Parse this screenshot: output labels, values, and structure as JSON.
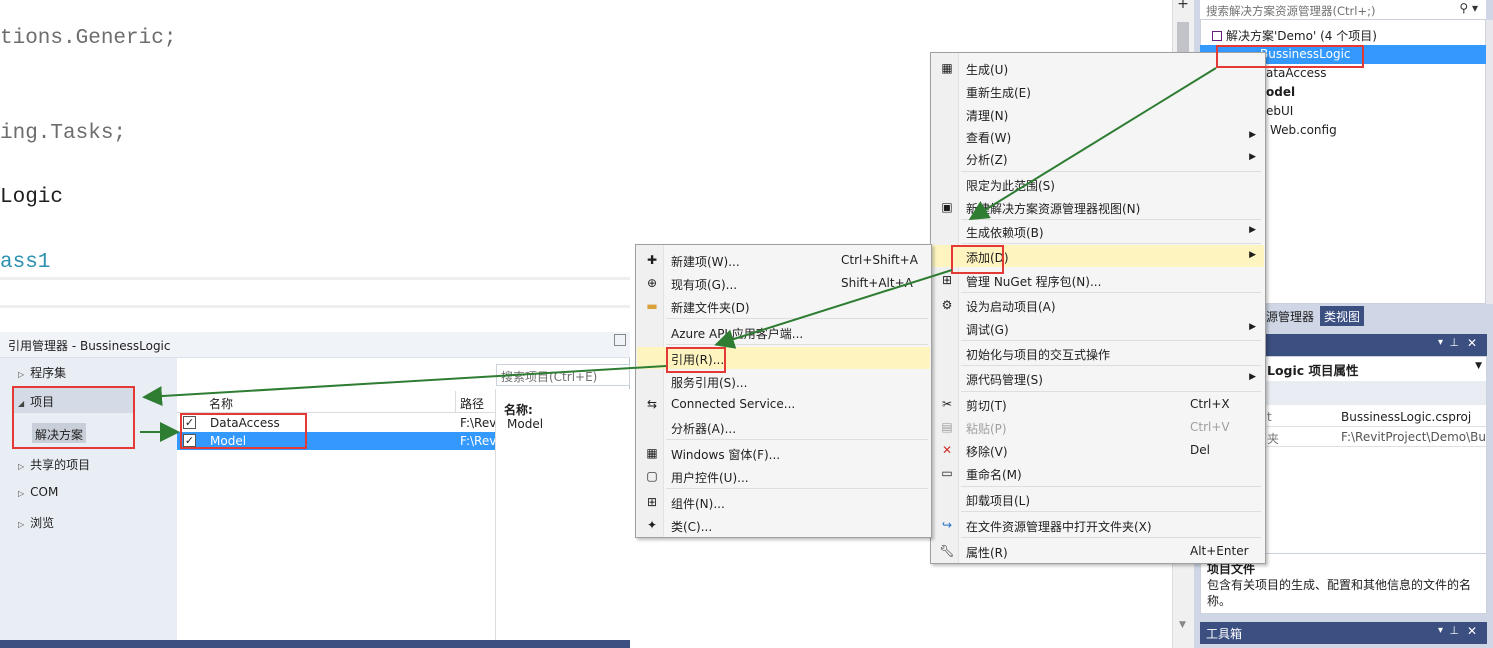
{
  "editor": {
    "lines": [
      {
        "text": "tions.Generic;",
        "color": "#6d6d6d"
      },
      {
        "text": "ing.Tasks;",
        "color": "#6d6d6d"
      },
      {
        "text": "Logic",
        "color": "#1e1e1e"
      },
      {
        "text": "ass1",
        "color": "#2b91af"
      }
    ]
  },
  "solution_explorer": {
    "search_placeholder": "搜索解决方案资源管理器(Ctrl+;)",
    "search_icon": "search-icon",
    "items": [
      "解决方案'Demo' (4 个项目)",
      "BussinessLogic",
      "ataAccess",
      "odel",
      "ebUI",
      "Web.config"
    ]
  },
  "panel_tabs": [
    "源管理器",
    "类视图"
  ],
  "properties": {
    "header_pin": "⊥",
    "title": "Logic 项目属性",
    "rows": [
      {
        "key": "t",
        "value": "BussinessLogic.csproj"
      },
      {
        "key": "夹",
        "value": "F:\\RevitProject\\Demo\\Bu"
      }
    ],
    "desc_title": "项目文件",
    "desc_text": "包含有关项目的生成、配置和其他信息的文件的名称。"
  },
  "toolbox": {
    "title": "工具箱"
  },
  "reference_manager": {
    "title": "引用管理器 - BussinessLogic",
    "search_placeholder": "搜索项目(Ctrl+E)",
    "nav": [
      {
        "label": "程序集",
        "expanded": false
      },
      {
        "label": "项目",
        "expanded": true
      },
      {
        "label": "解决方案",
        "child": true
      },
      {
        "label": "共享的项目",
        "expanded": false
      },
      {
        "label": "COM",
        "expanded": false
      },
      {
        "label": "浏览",
        "expanded": false
      }
    ],
    "columns": [
      "名称",
      "路径"
    ],
    "rows": [
      {
        "name": "DataAccess",
        "path": "F:\\Rev",
        "checked": true
      },
      {
        "name": "Model",
        "path": "F:\\Rev",
        "checked": true
      }
    ],
    "detail_label": "名称:",
    "detail_value": "Model"
  },
  "context_menu_main": {
    "items": [
      {
        "label": "生成(U)",
        "icon": "build-icon"
      },
      {
        "label": "重新生成(E)"
      },
      {
        "label": "清理(N)"
      },
      {
        "label": "查看(W)",
        "submenu": true
      },
      {
        "label": "分析(Z)",
        "submenu": true
      },
      {
        "sep": true
      },
      {
        "label": "限定为此范围(S)"
      },
      {
        "label": "新建解决方案资源管理器视图(N)",
        "icon": "new-view-icon"
      },
      {
        "sep": true
      },
      {
        "label": "生成依赖项(B)",
        "submenu": true
      },
      {
        "sep": true
      },
      {
        "label": "添加(D)",
        "submenu": true,
        "highlight": true
      },
      {
        "label": "管理 NuGet 程序包(N)...",
        "icon": "nuget-icon"
      },
      {
        "sep": true
      },
      {
        "label": "设为启动项目(A)",
        "icon": "gear-icon"
      },
      {
        "label": "调试(G)",
        "submenu": true
      },
      {
        "sep": true
      },
      {
        "label": "初始化与项目的交互式操作"
      },
      {
        "sep": true
      },
      {
        "label": "源代码管理(S)",
        "submenu": true
      },
      {
        "sep": true
      },
      {
        "label": "剪切(T)",
        "shortcut": "Ctrl+X",
        "icon": "cut-icon"
      },
      {
        "label": "粘贴(P)",
        "shortcut": "Ctrl+V",
        "icon": "paste-icon",
        "disabled": true
      },
      {
        "label": "移除(V)",
        "shortcut": "Del",
        "icon": "remove-icon"
      },
      {
        "label": "重命名(M)",
        "icon": "rename-icon"
      },
      {
        "sep": true
      },
      {
        "label": "卸载项目(L)"
      },
      {
        "sep": true
      },
      {
        "label": "在文件资源管理器中打开文件夹(X)",
        "icon": "open-folder-icon"
      },
      {
        "sep": true
      },
      {
        "label": "属性(R)",
        "shortcut": "Alt+Enter",
        "icon": "wrench-icon"
      }
    ]
  },
  "context_menu_add": {
    "items": [
      {
        "label": "新建项(W)...",
        "shortcut": "Ctrl+Shift+A",
        "icon": "new-item-icon"
      },
      {
        "label": "现有项(G)...",
        "shortcut": "Shift+Alt+A",
        "icon": "existing-item-icon"
      },
      {
        "label": "新建文件夹(D)",
        "icon": "new-folder-icon"
      },
      {
        "sep": true
      },
      {
        "label": "Azure API 应用客户端..."
      },
      {
        "sep": true
      },
      {
        "label": "引用(R)...",
        "highlight": true
      },
      {
        "label": "服务引用(S)..."
      },
      {
        "label": "Connected Service...",
        "icon": "connected-service-icon"
      },
      {
        "label": "分析器(A)..."
      },
      {
        "sep": true
      },
      {
        "label": "Windows 窗体(F)...",
        "icon": "form-icon"
      },
      {
        "label": "用户控件(U)...",
        "icon": "user-control-icon"
      },
      {
        "sep": true
      },
      {
        "label": "组件(N)...",
        "icon": "component-icon"
      },
      {
        "label": "类(C)...",
        "icon": "class-icon"
      }
    ]
  },
  "colors": {
    "accent": "#3399ff",
    "annotation_red": "#e53935",
    "arrow_green": "#2e7d32",
    "highlight": "#fdf4bf"
  }
}
